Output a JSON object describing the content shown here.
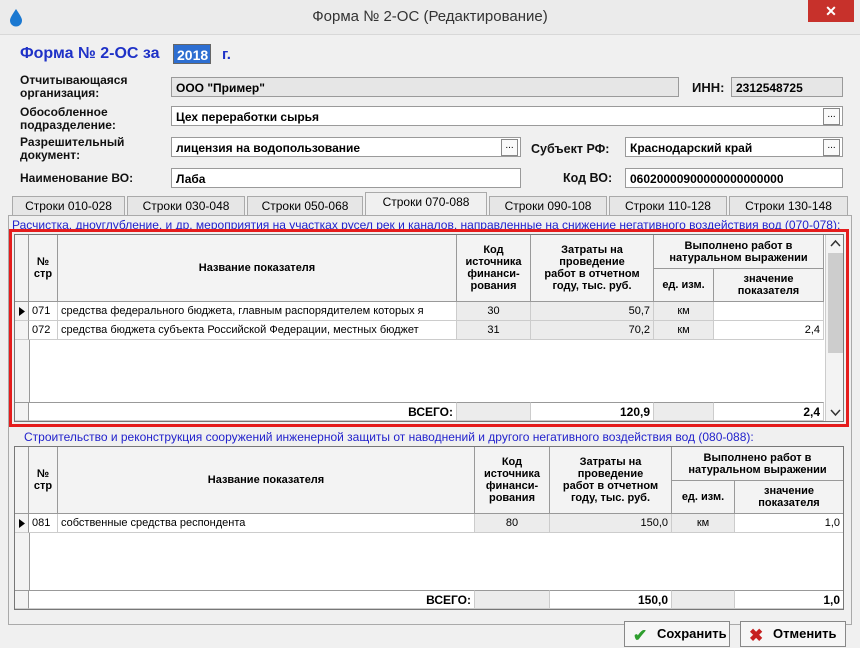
{
  "window": {
    "title": "Форма № 2-ОС (Редактирование)",
    "close": "✕"
  },
  "header": {
    "form_label": "Форма № 2-ОС за",
    "year": "2018",
    "year_suffix": "г."
  },
  "fields": {
    "org_label": "Отчитывающаяся\nорганизация:",
    "org_value": "ООО \"Пример\"",
    "inn_label": "ИНН:",
    "inn_value": "2312548725",
    "subdiv_label": "Обособленное\nподразделение:",
    "subdiv_value": "Цех переработки сырья",
    "permit_label": "Разрешительный\nдокумент:",
    "permit_value": "лицензия на водопользование",
    "region_label": "Субъект РФ:",
    "region_value": "Краснодарский край",
    "vo_label": "Наименование ВО:",
    "vo_value": "Лаба",
    "vocode_label": "Код ВО:",
    "vocode_value": "06020000900000000000000",
    "dots": "..."
  },
  "tabs": [
    "Строки 010-028",
    "Строки 030-048",
    "Строки 050-068",
    "Строки 070-088",
    "Строки 090-108",
    "Строки 110-128",
    "Строки 130-148"
  ],
  "active_tab": "Строки 070-088",
  "headers": {
    "num": "№\nстр",
    "name": "Название показателя",
    "code": "Код\nисточника\nфинанси-\nрования",
    "cost": "Затраты на\nпроведение\nработ в отчетном\nгоду, тыс. руб.",
    "done": "Выполнено работ в\nнатуральном выражении",
    "unit": "ед. изм.",
    "value": "значение\nпоказателя"
  },
  "section1": {
    "title": "Расчистка, дноуглубление, и др. мероприятия на участках русел рек и каналов, направленные на снижение негативного воздействия вод (070-078):",
    "rows": [
      {
        "num": "071",
        "name": "средства федерального бюджета, главным распорядителем которых я",
        "code": "30",
        "cost": "50,7",
        "unit": "км",
        "value": ""
      },
      {
        "num": "072",
        "name": "средства бюджета субъекта Российской Федерации, местных бюджет",
        "code": "31",
        "cost": "70,2",
        "unit": "км",
        "value": "2,4"
      }
    ],
    "total_label": "ВСЕГО:",
    "total_cost": "120,9",
    "total_value": "2,4"
  },
  "section2": {
    "title": "Строительство и реконструкция сооружений инженерной защиты от наводнений и другого негативного воздействия вод (080-088):",
    "rows": [
      {
        "num": "081",
        "name": "собственные средства респондента",
        "code": "80",
        "cost": "150,0",
        "unit": "км",
        "value": "1,0"
      }
    ],
    "total_label": "ВСЕГО:",
    "total_cost": "150,0",
    "total_value": "1,0"
  },
  "buttons": {
    "save": "Сохранить",
    "cancel": "Отменить"
  }
}
